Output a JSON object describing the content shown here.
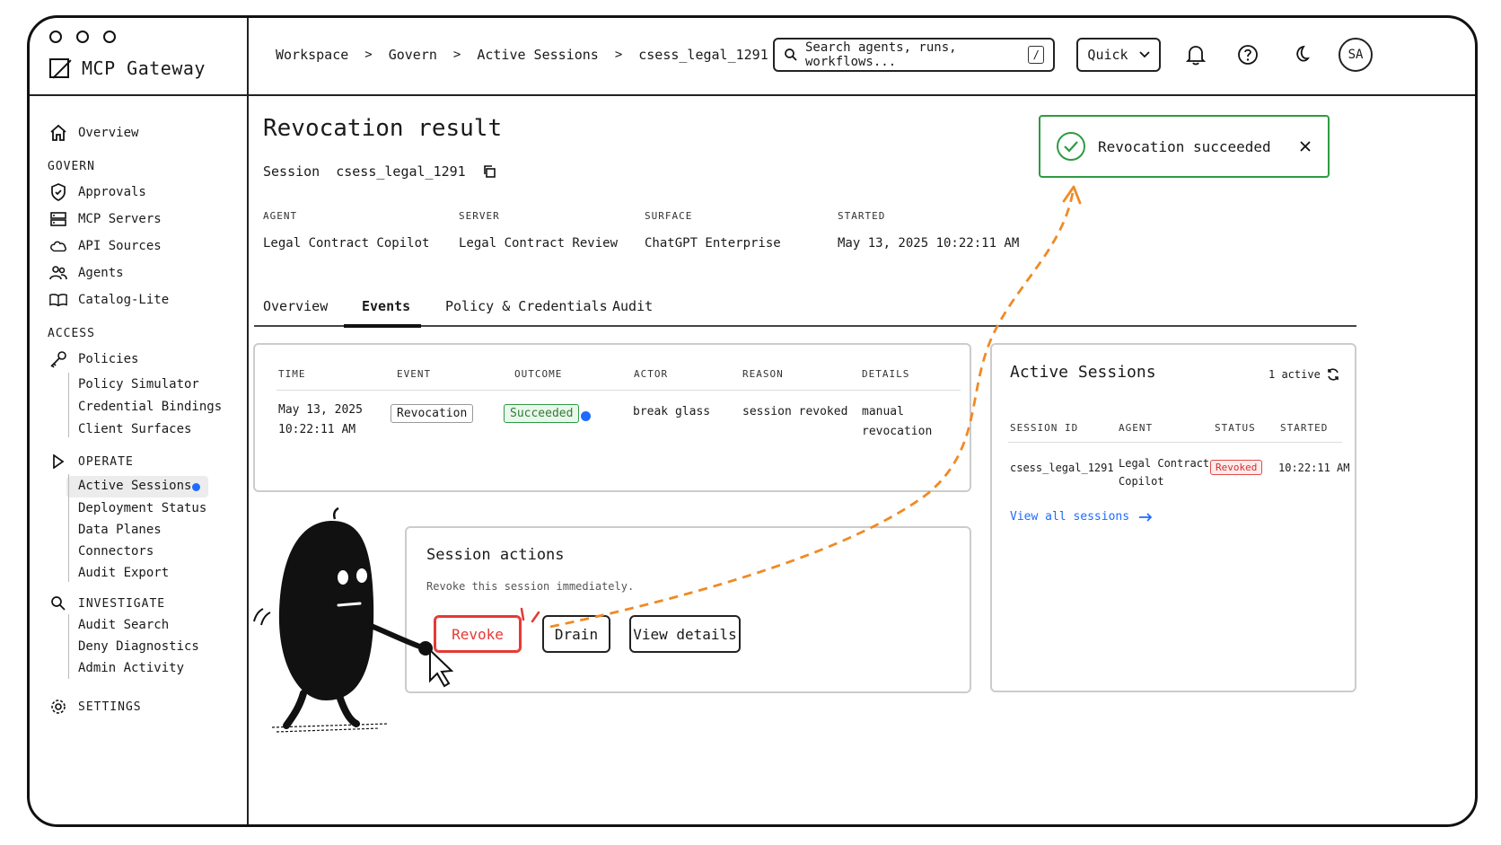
{
  "app": {
    "title": "MCP Gateway",
    "avatar_initials": "SA"
  },
  "breadcrumb": [
    "Workspace",
    "Govern",
    "Active Sessions",
    "csess_legal_1291"
  ],
  "search": {
    "placeholder": "Search agents, runs, workflows...",
    "shortcut": "/"
  },
  "quick_label": "Quick",
  "sidebar": {
    "overview": "Overview",
    "govern_header": "GOVERN",
    "govern_items": [
      "Approvals",
      "MCP Servers",
      "API Sources",
      "Agents",
      "Catalog-Lite"
    ],
    "access_header": "ACCESS",
    "policies": "Policies",
    "access_sub": [
      "Policy Simulator",
      "Credential Bindings",
      "Client Surfaces"
    ],
    "operate_header": "OPERATE",
    "operate_sub": [
      "Active Sessions",
      "Deployment Status",
      "Data Planes",
      "Connectors",
      "Audit Export"
    ],
    "investigate_header": "INVESTIGATE",
    "investigate_sub": [
      "Audit Search",
      "Deny Diagnostics",
      "Admin Activity"
    ],
    "settings": "SETTINGS"
  },
  "page": {
    "title": "Revocation result",
    "session_label": "Session",
    "session_id": "csess_legal_1291",
    "meta": [
      {
        "label": "AGENT",
        "value": "Legal Contract Copilot"
      },
      {
        "label": "SERVER",
        "value": "Legal Contract Review"
      },
      {
        "label": "SURFACE",
        "value": "ChatGPT Enterprise"
      },
      {
        "label": "STARTED",
        "value": "May 13, 2025 10:22:11 AM"
      }
    ],
    "tabs": [
      "Overview",
      "Events",
      "Policy & Credentials",
      "Audit"
    ],
    "active_tab": "Events"
  },
  "events_table": {
    "headers": [
      "TIME",
      "EVENT",
      "OUTCOME",
      "ACTOR",
      "REASON",
      "DETAILS"
    ],
    "row": {
      "time_line1": "May 13, 2025",
      "time_line2": "10:22:11 AM",
      "event": "Revocation",
      "outcome": "Succeeded",
      "actor": "break glass",
      "reason": "session revoked",
      "details": "manual revocation"
    }
  },
  "session_actions": {
    "title": "Session actions",
    "subtitle": "Revoke this session immediately.",
    "revoke": "Revoke",
    "drain": "Drain",
    "view_details": "View details"
  },
  "active_sessions": {
    "title": "Active Sessions",
    "count": "1 active",
    "headers": [
      "SESSION ID",
      "AGENT",
      "STATUS",
      "STARTED"
    ],
    "row": {
      "session_id": "csess_legal_1291",
      "agent_line1": "Legal Contract",
      "agent_line2": "Copilot",
      "status": "Revoked",
      "started": "10:22:11 AM"
    },
    "view_all": "View all sessions"
  },
  "toast": {
    "message": "Revocation succeeded"
  },
  "colors": {
    "success": "#2e9b42",
    "danger": "#e53935",
    "accent": "#1f6bff",
    "arrow": "#f08a24"
  },
  "icons": [
    "home-icon",
    "shield-icon",
    "server-icon",
    "cloud-icon",
    "users-icon",
    "book-icon",
    "key-icon",
    "play-icon",
    "search-icon",
    "gear-icon",
    "bell-icon",
    "help-icon",
    "moon-icon",
    "copy-icon",
    "refresh-icon",
    "check-icon",
    "close-icon",
    "arrow-right-icon",
    "chevron-down-icon",
    "cursor-icon"
  ]
}
